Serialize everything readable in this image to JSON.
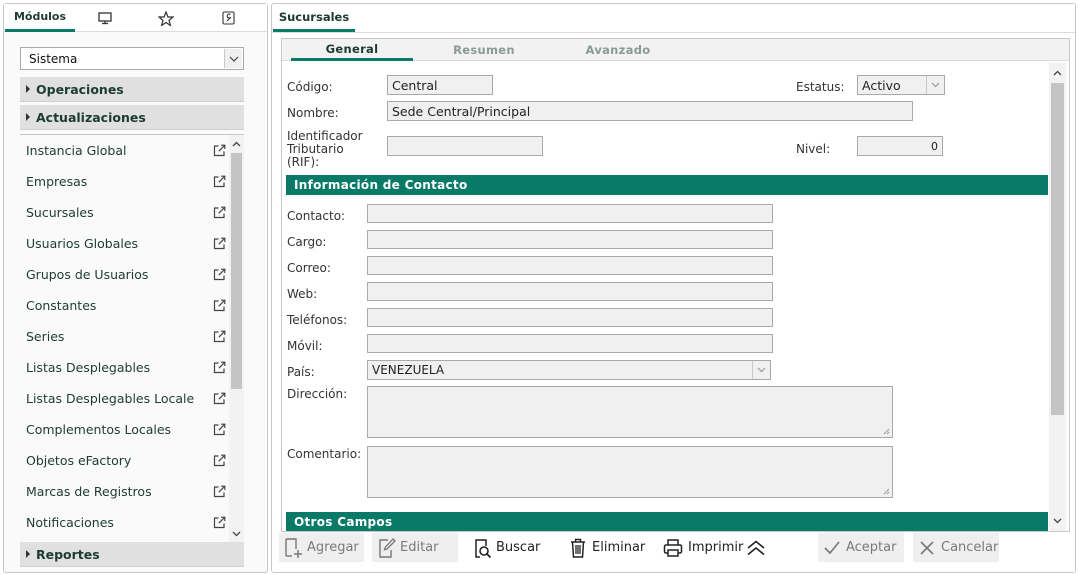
{
  "left_tabs": {
    "modules_label": "Módulos",
    "tab2_icon": "monitor-icon",
    "tab3_icon": "star-icon",
    "tab4_icon": "wrench-icon"
  },
  "module_select": {
    "value": "Sistema"
  },
  "groups": {
    "operaciones": "Operaciones",
    "actualizaciones": "Actualizaciones",
    "reportes": "Reportes"
  },
  "menu_items": [
    "Instancia Global",
    "Empresas",
    "Sucursales",
    "Usuarios Globales",
    "Grupos de Usuarios",
    "Constantes",
    "Series",
    "Listas Desplegables",
    "Listas Desplegables Locale",
    "Complementos Locales",
    "Objetos eFactory",
    "Marcas de Registros",
    "Notificaciones"
  ],
  "right": {
    "title": "Sucursales",
    "subtabs": [
      "General",
      "Resumen",
      "Avanzado"
    ]
  },
  "form": {
    "codigo_label": "Código:",
    "codigo_value": "Central",
    "estatus_label": "Estatus:",
    "estatus_value": "Activo",
    "nombre_label": "Nombre:",
    "nombre_value": "Sede Central/Principal",
    "rif_label_1": "Identificador",
    "rif_label_2": "Tributario",
    "rif_label_3": "(RIF):",
    "rif_value": "",
    "nivel_label": "Nivel:",
    "nivel_value": "0",
    "contact_section": "Información de Contacto",
    "contacto_label": "Contacto:",
    "cargo_label": "Cargo:",
    "correo_label": "Correo:",
    "web_label": "Web:",
    "telefonos_label": "Teléfonos:",
    "movil_label": "Móvil:",
    "pais_label": "País:",
    "pais_value": "VENEZUELA",
    "direccion_label": "Dirección:",
    "comentario_label": "Comentario:",
    "otros_section": "Otros Campos"
  },
  "toolbar": {
    "agregar": "Agregar",
    "editar": "Editar",
    "buscar": "Buscar",
    "eliminar": "Eliminar",
    "imprimir": "Imprimir",
    "aceptar": "Aceptar",
    "cancelar": "Cancelar"
  },
  "colors": {
    "accent": "#0a7a68",
    "text_dark": "#1d3b33",
    "field_bg": "#f0f0f0"
  }
}
